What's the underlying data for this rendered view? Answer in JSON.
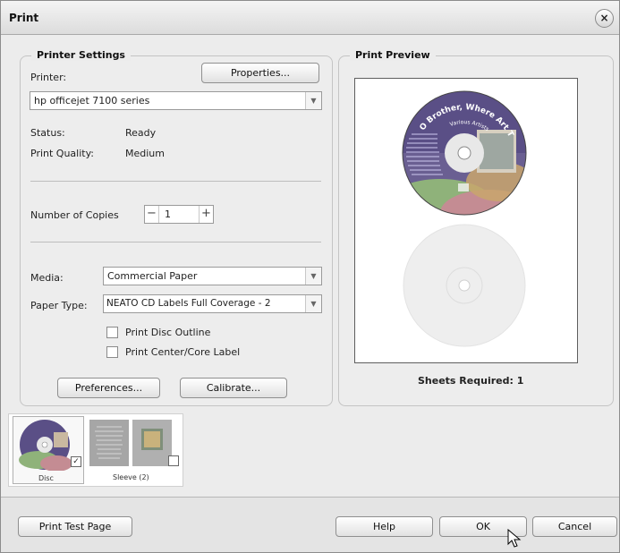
{
  "window": {
    "title": "Print",
    "close_label": "×"
  },
  "printer_settings": {
    "legend": "Printer Settings",
    "printer_label": "Printer:",
    "properties_button": "Properties...",
    "printer_value": "hp officejet 7100 series",
    "status_label": "Status:",
    "status_value": "Ready",
    "quality_label": "Print Quality:",
    "quality_value": "Medium",
    "copies_label": "Number of Copies",
    "copies_value": "1",
    "copies_minus": "−",
    "copies_plus": "+",
    "media_label": "Media:",
    "media_value": "Commercial Paper",
    "paper_type_label": "Paper Type:",
    "paper_type_value": "NEATO CD Labels Full Coverage - 2",
    "print_disc_outline": "Print Disc Outline",
    "print_center_label": "Print Center/Core Label",
    "preferences_button": "Preferences...",
    "calibrate_button": "Calibrate..."
  },
  "print_preview": {
    "legend": "Print Preview",
    "disc_title_text": "O Brother, Where Art Thou?",
    "disc_subtitle_text": "Various Artists",
    "sheets_required": "Sheets Required: 1"
  },
  "thumbnails": [
    {
      "caption": "Disc",
      "checked": true
    },
    {
      "caption": "Sleeve (2)",
      "checked": false
    }
  ],
  "footer": {
    "print_test_page": "Print Test Page",
    "help": "Help",
    "ok": "OK",
    "cancel": "Cancel"
  },
  "colors": {
    "disc_purple": "#5a4f86",
    "disc_green": "#8fb27a",
    "disc_gold": "#c9a66c",
    "disc_rose": "#c48c93",
    "ghost_disc": "#ededed"
  }
}
